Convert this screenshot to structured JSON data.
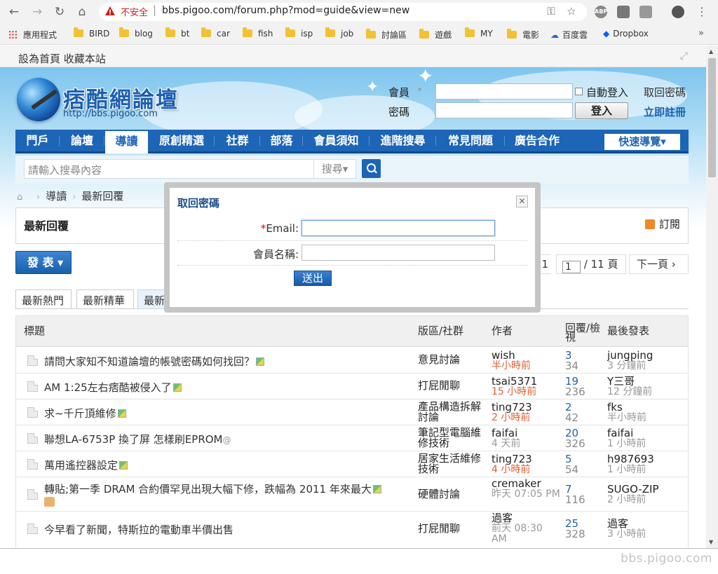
{
  "browser": {
    "security_label": "不安全",
    "url": "bbs.pigoo.com/forum.php?mod=guide&view=new",
    "extension_abp": "ABP",
    "bookmarks": [
      "應用程式",
      "BIRD",
      "blog",
      "bt",
      "car",
      "fish",
      "isp",
      "job",
      "討論區",
      "遊戲",
      "MY",
      "電影",
      "百度雲",
      "Dropbox"
    ]
  },
  "topline": {
    "text": "設為首頁  收藏本站"
  },
  "logo": {
    "title": "痞酷網論壇",
    "url": "http://bbs.pigoo.com"
  },
  "login": {
    "member_label": "會員",
    "password_label": "密碼",
    "auto_login": "自動登入",
    "retrieve_password": "取回密碼",
    "login_button": "登入",
    "register": "立即註冊"
  },
  "nav": {
    "items": [
      "門戶",
      "論壇",
      "導讀",
      "原創精選",
      "社群",
      "部落",
      "會員須知",
      "進階搜尋",
      "常見問題",
      "廣告合作"
    ],
    "active_index": 2,
    "quick_nav": "快速導覽▾"
  },
  "search": {
    "placeholder": "請輸入搜尋內容",
    "type": "搜尋▾"
  },
  "breadcrumb": [
    "導讀",
    "最新回覆"
  ],
  "box": {
    "title": "最新回覆",
    "subscribe": "訂閱"
  },
  "post_button": "發 表 ▾",
  "pager": {
    "prev_label": "11",
    "current": "1",
    "total": "/ 11 頁",
    "next": "下一頁 ›"
  },
  "tabs": [
    "最新熱門",
    "最新精華",
    "最新回覆"
  ],
  "table": {
    "headers": [
      "標題",
      "版區/社群",
      "作者",
      "回覆/檢視",
      "最後發表"
    ],
    "rows": [
      {
        "subject": "請問大家知不知道論壇的帳號密碼如何找回？",
        "forum": "意見討論",
        "author": "wish",
        "author_time": "半小時前",
        "replies": "3",
        "views": "34",
        "last_user": "jungping",
        "last_time": "3 分鐘前"
      },
      {
        "subject": "AM 1:25左右痞酷被侵入了",
        "forum": "打屁閒聊",
        "author": "tsai5371",
        "author_time": "15 小時前",
        "replies": "19",
        "views": "236",
        "last_user": "Y三哥",
        "last_time": "12 分鐘前"
      },
      {
        "subject": "求~千斤頂維修",
        "forum": "產品構造拆解討論",
        "author": "ting723",
        "author_time": "2 小時前",
        "replies": "2",
        "views": "42",
        "last_user": "fks",
        "last_time": "半小時前"
      },
      {
        "subject": "聯想LA-6753P 換了屏 怎樣刷EPROM",
        "forum": "筆記型電腦維修技術",
        "author": "faifai",
        "author_time": "4 天前",
        "replies": "20",
        "views": "326",
        "last_user": "faifai",
        "last_time": "1 小時前"
      },
      {
        "subject": "萬用遙控器設定",
        "forum": "居家生活維修技術",
        "author": "ting723",
        "author_time": "4 小時前",
        "replies": "5",
        "views": "54",
        "last_user": "h987693",
        "last_time": "1 小時前"
      },
      {
        "subject": "轉貼;第一季 DRAM 合約價罕見出現大幅下修，跌幅為 2011 年來最大",
        "forum": "硬體討論",
        "author": "cremaker",
        "author_time": "昨天 07:05 PM",
        "replies": "7",
        "views": "116",
        "last_user": "SUGO-ZIP",
        "last_time": "2 小時前"
      },
      {
        "subject": "今早看了新聞，特斯拉的電動車半價出售",
        "forum": "打屁閒聊",
        "author": "過客",
        "author_time": "前天 08:30 AM",
        "replies": "25",
        "views": "328",
        "last_user": "過客",
        "last_time": "3 小時前"
      }
    ]
  },
  "modal": {
    "title": "取回密碼",
    "close": "✕",
    "required_mark": "*",
    "email_label": "Email:",
    "username_label": "會員名稱:",
    "submit": "送出"
  },
  "watermark": "bbs.pigoo.com"
}
